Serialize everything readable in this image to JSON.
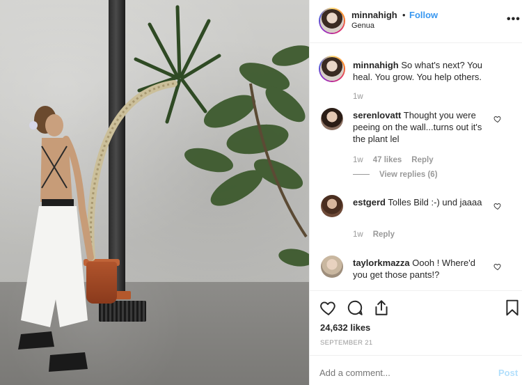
{
  "post": {
    "username": "minnahigh",
    "separator": "•",
    "follow_label": "Follow",
    "location": "Genua",
    "more_label": "•••"
  },
  "caption": {
    "username": "minnahigh",
    "text": "So what's next? You heal. You grow. You help others.",
    "time": "1w"
  },
  "comments": [
    {
      "username": "serenlovatt",
      "text": "Thought you were peeing on the wall...turns out it's the plant lel",
      "time": "1w",
      "likes": "47 likes",
      "reply_label": "Reply",
      "view_replies": "View replies (6)"
    },
    {
      "username": "estgerd",
      "text": "Tolles Bild :-) und jaaaa",
      "time": "1w",
      "reply_label": "Reply"
    },
    {
      "username": "taylorkmazza",
      "text": "Oooh ! Where'd you get those pants!?"
    }
  ],
  "stats": {
    "likes": "24,632 likes",
    "date": "SEPTEMBER 21"
  },
  "add_comment": {
    "placeholder": "Add a comment...",
    "post_label": "Post"
  },
  "colors": {
    "accent": "#3897f0",
    "post_disabled": "#b2dffc",
    "muted": "#999999",
    "text": "#262626"
  },
  "icons": {
    "like": "heart-icon",
    "comment": "comment-icon",
    "share": "share-icon",
    "save": "bookmark-icon"
  }
}
